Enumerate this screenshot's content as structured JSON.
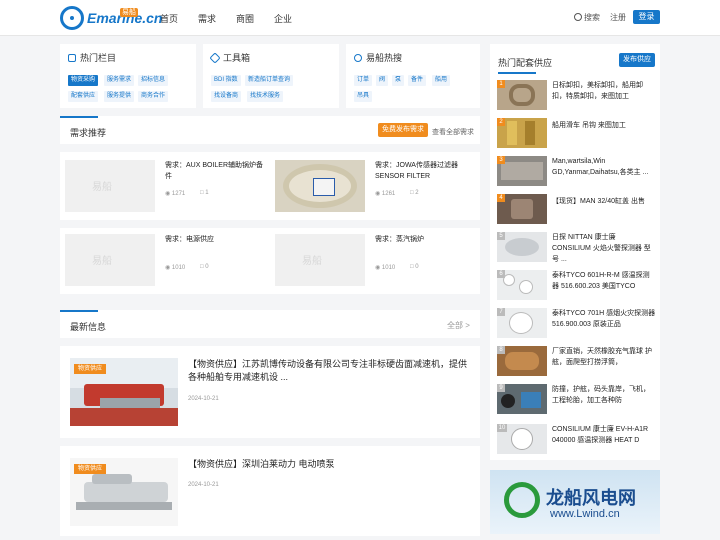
{
  "header": {
    "logo_text": "Emarine.cn",
    "logo_badge": "易船",
    "nav": [
      "首页",
      "需求",
      "商圈",
      "企业"
    ],
    "search_label": "搜索",
    "register_label": "注册",
    "login_label": "登录"
  },
  "panels": [
    {
      "title": "热门栏目",
      "tags": [
        "物资采购",
        "服务需求",
        "招标信息",
        "配套供应",
        "服务提供",
        "商务合作"
      ]
    },
    {
      "title": "工具箱",
      "tags": [
        "BDI 指数",
        "新造船订单查询",
        "找设备商",
        "找技术服务"
      ]
    },
    {
      "title": "易船热搜",
      "tags": [
        "订单",
        "阀",
        "泵",
        "备件",
        "船用",
        "吊具"
      ]
    }
  ],
  "demand": {
    "title": "需求推荐",
    "post_button": "免费发布需求",
    "more": "查看全部需求",
    "watermark": "易船",
    "items": [
      {
        "title": "需求：AUX BOILER辅助锅炉备件",
        "views": "1271",
        "comments": "1"
      },
      {
        "title": "需求：JOWA传感器过滤器SENSOR FILTER",
        "views": "1261",
        "comments": "2"
      },
      {
        "title": "需求：电源供应",
        "views": "1010",
        "comments": "0"
      },
      {
        "title": "需求：蒸汽锅炉",
        "views": "1010",
        "comments": "0"
      }
    ]
  },
  "news": {
    "title": "最新信息",
    "more": "全部 >",
    "items": [
      {
        "tag": "物资供应",
        "title": "【物资供应】江苏凯博传动设备有限公司专注非标硬齿面减速机，提供各种船舶专用减速机设 ...",
        "date": "2024-10-21"
      },
      {
        "tag": "物资供应",
        "title": "【物资供应】深圳泊莱动力 电动喷泵",
        "date": "2024-10-21"
      }
    ]
  },
  "sidebar": {
    "title": "热门配套供应",
    "button": "发布供应",
    "items": [
      {
        "num": "1",
        "title": "日标卸扣，美标卸扣，船用卸扣，特质卸扣，来图加工"
      },
      {
        "num": "2",
        "title": "船用滑车 吊钩 来图加工"
      },
      {
        "num": "3",
        "title": "Man,wartsila,Win GD,Yanmar,Daihatsu,各类主 ..."
      },
      {
        "num": "4",
        "title": "【现货】MAN 32/40缸盖 出售"
      },
      {
        "num": "5",
        "title": "日探 NITTAN 康士廉 CONSILIUM 火焰火警探测器 型号 ..."
      },
      {
        "num": "6",
        "title": "泰科TYCO 601H-R-M 感温探测器 516.600.203 美国TYCO"
      },
      {
        "num": "7",
        "title": "泰科TYCO 701H 感烟火灾探测器 516.900.003 原装正品"
      },
      {
        "num": "8",
        "title": "厂家直销，天然橡胶充气靠球 护舷，面爬型打捞浮筒，"
      },
      {
        "num": "9",
        "title": "防撞，护舷，码头靠岸，飞机，工程轮胎，加工各种防"
      },
      {
        "num": "10",
        "title": "CONSILIUM 康士廉 EV-H-A1R 040000 感温探测器 HEAT D"
      }
    ]
  },
  "ad": {
    "title": "龙船风电网",
    "url": "www.Lwind.cn"
  },
  "colors": {
    "primary": "#1677c9",
    "accent": "#f08c1e",
    "background": "#f4f5f7"
  }
}
